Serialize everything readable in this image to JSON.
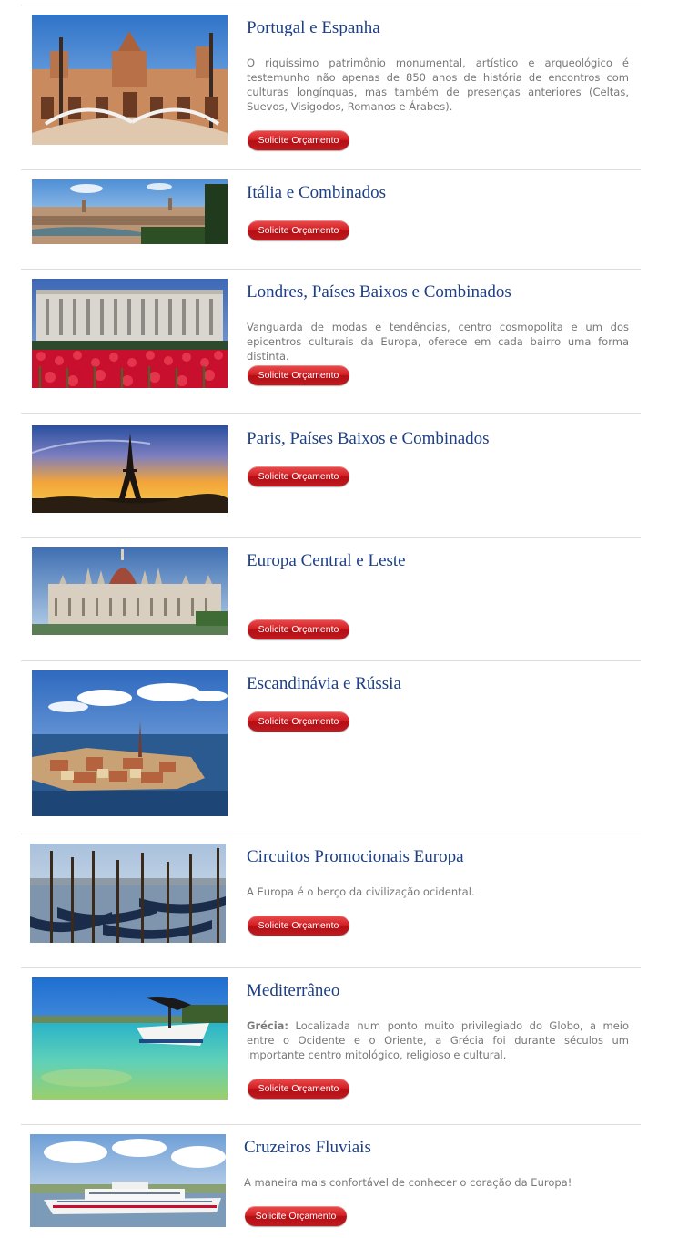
{
  "items": [
    {
      "title": "Portugal e Espanha",
      "description": "O riquíssimo patrimônio monumental, artístico e arqueológico é testemunho não apenas de 850 anos de história de encontros com culturas longínquas,  mas também de presenças anteriores (Celtas, Suevos, Visigodos, Romanos e Árabes).",
      "button": "Solicite Orçamento"
    },
    {
      "title": "Itália e Combinados",
      "button": "Solicite Orçamento"
    },
    {
      "title": "Londres, Países Baixos e Combinados",
      "description": "Vanguarda de modas e tendências, centro cosmopolita e um dos epicentros culturais da Europa, oferece em cada bairro uma forma distinta.",
      "button": "Solicite Orçamento"
    },
    {
      "title": "Paris, Países Baixos e Combinados",
      "button": "Solicite Orçamento"
    },
    {
      "title": "Europa Central e Leste",
      "button": "Solicite Orçamento"
    },
    {
      "title": "Escandinávia e Rússia",
      "button": "Solicite Orçamento"
    },
    {
      "title": "Circuitos Promocionais Europa",
      "description": "A Europa é o berço da civilização ocidental.",
      "button": "Solicite Orçamento"
    },
    {
      "title": "Mediterrâneo",
      "description_label": "Grécia:",
      "description": "Localizada num ponto muito privilegiado do Globo, a meio entre o Ocidente e o Oriente, a Grécia foi durante séculos um importante centro mitológico, religioso e cultural.",
      "button": "Solicite Orçamento"
    },
    {
      "title": "Cruzeiros Fluviais",
      "description": "A maneira mais confortável de conhecer o coração da Europa!",
      "button": "Solicite Orçamento"
    }
  ]
}
